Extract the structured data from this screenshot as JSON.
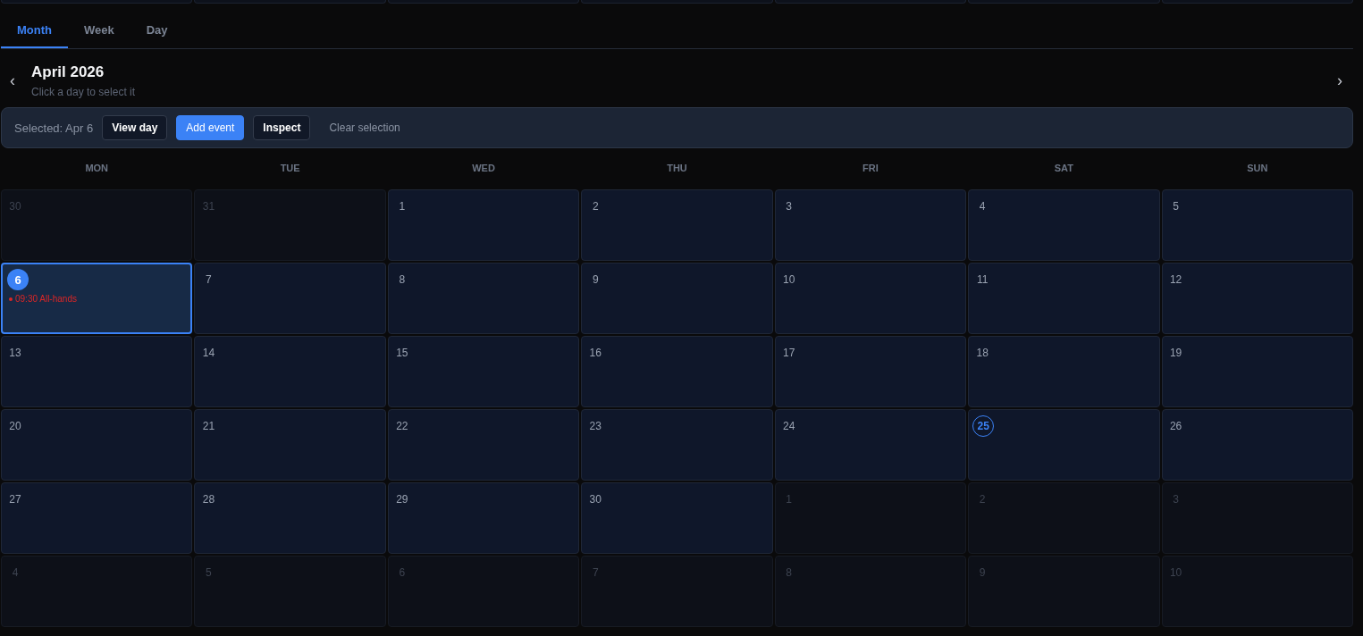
{
  "tabs": [
    {
      "label": "Month",
      "selected": true
    },
    {
      "label": "Week",
      "selected": false
    },
    {
      "label": "Day",
      "selected": false
    }
  ],
  "header": {
    "prev": "‹",
    "title": "April 2026",
    "subtitle": "Click a day to select it",
    "next": "›"
  },
  "selection_bar": {
    "label": "Selected: Apr 6",
    "buttons": [
      {
        "label": "View day",
        "kind": "outline"
      },
      {
        "label": "Add event",
        "kind": "primary"
      },
      {
        "label": "Inspect",
        "kind": "outline"
      },
      {
        "label": "Clear selection",
        "kind": "plain"
      }
    ]
  },
  "weekdays": [
    "MON",
    "TUE",
    "WED",
    "THU",
    "FRI",
    "SAT",
    "SUN"
  ],
  "weeks": [
    [
      {
        "day": "30",
        "outside": true,
        "selected": false,
        "today": false
      },
      {
        "day": "31",
        "outside": true,
        "selected": false,
        "today": false
      },
      {
        "day": "1",
        "outside": false,
        "selected": false,
        "today": false
      },
      {
        "day": "2",
        "outside": false,
        "selected": false,
        "today": false
      },
      {
        "day": "3",
        "outside": false,
        "selected": false,
        "today": false
      },
      {
        "day": "4",
        "outside": false,
        "selected": false,
        "today": false
      },
      {
        "day": "5",
        "outside": false,
        "selected": false,
        "today": false
      }
    ],
    [
      {
        "day": "6",
        "outside": false,
        "selected": true,
        "today": false,
        "events": [
          {
            "label": "09:30 All-hands",
            "color": "#dc2626"
          }
        ]
      },
      {
        "day": "7",
        "outside": false,
        "selected": false,
        "today": false
      },
      {
        "day": "8",
        "outside": false,
        "selected": false,
        "today": false
      },
      {
        "day": "9",
        "outside": false,
        "selected": false,
        "today": false
      },
      {
        "day": "10",
        "outside": false,
        "selected": false,
        "today": false
      },
      {
        "day": "11",
        "outside": false,
        "selected": false,
        "today": false
      },
      {
        "day": "12",
        "outside": false,
        "selected": false,
        "today": false
      }
    ],
    [
      {
        "day": "13",
        "outside": false,
        "selected": false,
        "today": false
      },
      {
        "day": "14",
        "outside": false,
        "selected": false,
        "today": false
      },
      {
        "day": "15",
        "outside": false,
        "selected": false,
        "today": false
      },
      {
        "day": "16",
        "outside": false,
        "selected": false,
        "today": false
      },
      {
        "day": "17",
        "outside": false,
        "selected": false,
        "today": false
      },
      {
        "day": "18",
        "outside": false,
        "selected": false,
        "today": false
      },
      {
        "day": "19",
        "outside": false,
        "selected": false,
        "today": false
      }
    ],
    [
      {
        "day": "20",
        "outside": false,
        "selected": false,
        "today": false
      },
      {
        "day": "21",
        "outside": false,
        "selected": false,
        "today": false
      },
      {
        "day": "22",
        "outside": false,
        "selected": false,
        "today": false
      },
      {
        "day": "23",
        "outside": false,
        "selected": false,
        "today": false
      },
      {
        "day": "24",
        "outside": false,
        "selected": false,
        "today": false
      },
      {
        "day": "25",
        "outside": false,
        "selected": false,
        "today": true
      },
      {
        "day": "26",
        "outside": false,
        "selected": false,
        "today": false
      }
    ],
    [
      {
        "day": "27",
        "outside": false,
        "selected": false,
        "today": false
      },
      {
        "day": "28",
        "outside": false,
        "selected": false,
        "today": false
      },
      {
        "day": "29",
        "outside": false,
        "selected": false,
        "today": false
      },
      {
        "day": "30",
        "outside": false,
        "selected": false,
        "today": false
      },
      {
        "day": "1",
        "outside": true,
        "selected": false,
        "today": false
      },
      {
        "day": "2",
        "outside": true,
        "selected": false,
        "today": false
      },
      {
        "day": "3",
        "outside": true,
        "selected": false,
        "today": false
      }
    ],
    [
      {
        "day": "4",
        "outside": true,
        "selected": false,
        "today": false
      },
      {
        "day": "5",
        "outside": true,
        "selected": false,
        "today": false
      },
      {
        "day": "6",
        "outside": true,
        "selected": false,
        "today": false
      },
      {
        "day": "7",
        "outside": true,
        "selected": false,
        "today": false
      },
      {
        "day": "8",
        "outside": true,
        "selected": false,
        "today": false
      },
      {
        "day": "9",
        "outside": true,
        "selected": false,
        "today": false
      },
      {
        "day": "10",
        "outside": true,
        "selected": false,
        "today": false
      }
    ]
  ]
}
